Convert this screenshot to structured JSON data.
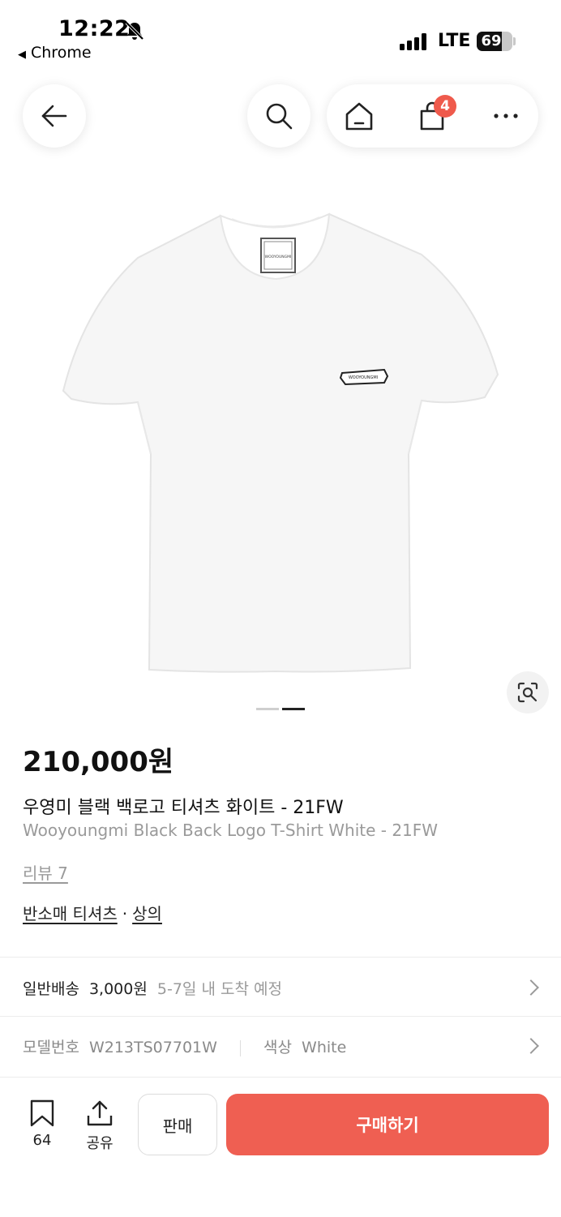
{
  "status": {
    "time": "12:22",
    "back_app": "Chrome",
    "network": "LTE",
    "battery": "69"
  },
  "nav": {
    "cart_count": "4"
  },
  "gallery": {
    "total": 2,
    "current": 2
  },
  "product": {
    "price": "210,000원",
    "name_ko": "우영미 블랙 백로고 티셔츠 화이트 - 21FW",
    "name_en": "Wooyoungmi Black Back Logo T-Shirt White - 21FW",
    "review": "리뷰 7",
    "category_1": "반소매 티셔츠",
    "category_sep": "·",
    "category_2": "상의",
    "logo_text": "WOOYOUNGMI"
  },
  "shipping": {
    "label": "일반배송",
    "fee": "3,000원",
    "eta": "5-7일 내 도착 예정"
  },
  "details": {
    "model_label": "모델번호",
    "model_value": "W213TS07701W",
    "color_label": "색상",
    "color_value": "White"
  },
  "bottom": {
    "bookmark_count": "64",
    "share_label": "공유",
    "sell_label": "판매",
    "buy_label": "구매하기"
  },
  "colors": {
    "accent": "#ef5f52",
    "badge": "#ef5a4c"
  }
}
